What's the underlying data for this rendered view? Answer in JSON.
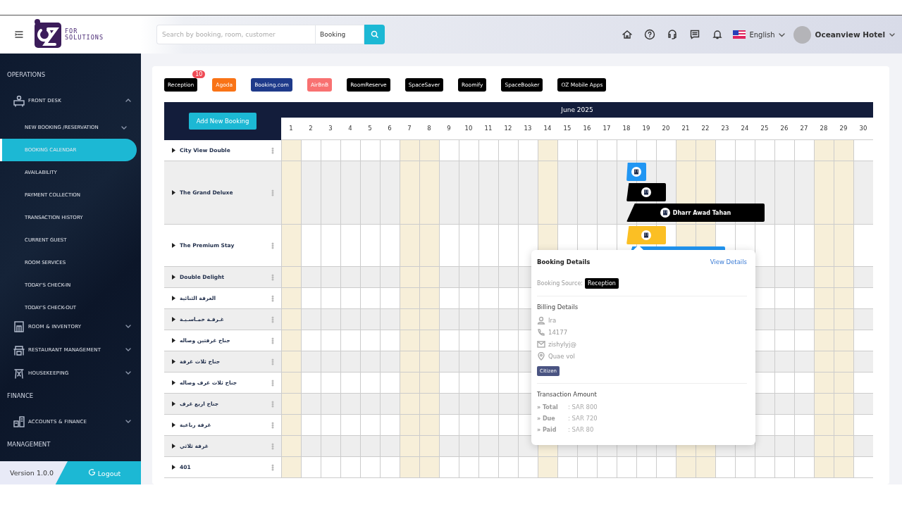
{
  "header": {
    "logo": {
      "line_1": "FOR",
      "line_2": "SOLUTIONS"
    },
    "search": {
      "placeholder": "Search by booking, room, customer",
      "scope": "Booking"
    },
    "language": "English",
    "user": "Oceanview Hotel"
  },
  "sidebar": {
    "sections": [
      {
        "title": "OPERATIONS",
        "items": [
          {
            "label": "FRONT DESK",
            "expanded": true,
            "children": [
              {
                "label": "NEW BOOKING /RESERVATION",
                "kind": "submenu",
                "selected": false
              },
              {
                "label": "BOOKING CALENDAR",
                "kind": "link",
                "selected": true
              },
              {
                "label": "AVAILABILITY",
                "kind": "link",
                "selected": false
              },
              {
                "label": "PAYMENT COLLECTION",
                "kind": "link",
                "selected": false
              },
              {
                "label": "TRANSACTION HISTORY",
                "kind": "link",
                "selected": false
              },
              {
                "label": "CURRENT GUEST",
                "kind": "link",
                "selected": false
              },
              {
                "label": "ROOM SERVICES",
                "kind": "link",
                "selected": false
              },
              {
                "label": "TODAY'S CHECK-IN",
                "kind": "link",
                "selected": false
              },
              {
                "label": "TODAY'S CHECK-OUT",
                "kind": "link",
                "selected": false
              }
            ]
          },
          {
            "label": "ROOM & INVENTORY",
            "expanded": false
          },
          {
            "label": "RESTAURANT MANAGEMENT",
            "expanded": false
          },
          {
            "label": "HOUSEKEEPING",
            "expanded": false
          }
        ]
      },
      {
        "title": "FINANCE",
        "items": [
          {
            "label": "ACCOUNTS & FINANCE",
            "expanded": false
          }
        ]
      },
      {
        "title": "MANAGEMENT"
      }
    ],
    "version": "Version 1.0.0",
    "logout": "Logout"
  },
  "sources": [
    {
      "label": "Reception",
      "color": "#000000",
      "badge": "10"
    },
    {
      "label": "Agoda",
      "color": "#f97316"
    },
    {
      "label": "Booking.com",
      "color": "#1e3a8a"
    },
    {
      "label": "AirBnB",
      "color": "#f87171"
    },
    {
      "label": "RoomReserve",
      "color": "#000000"
    },
    {
      "label": "SpaceSaver",
      "color": "#000000"
    },
    {
      "label": "Roomify",
      "color": "#000000"
    },
    {
      "label": "SpaceBooker",
      "color": "#000000"
    },
    {
      "label": "OZ Mobile Apps",
      "color": "#000000"
    }
  ],
  "calendar": {
    "add_button": "Add New Booking",
    "month": "June 2025",
    "days": [
      {
        "label": "1",
        "highlighted": true
      },
      {
        "label": "2",
        "highlighted": false
      },
      {
        "label": "3",
        "highlighted": false
      },
      {
        "label": "4",
        "highlighted": false
      },
      {
        "label": "5",
        "highlighted": false
      },
      {
        "label": "6",
        "highlighted": false
      },
      {
        "label": "7",
        "highlighted": true
      },
      {
        "label": "8",
        "highlighted": true
      },
      {
        "label": "9",
        "highlighted": false
      },
      {
        "label": "10",
        "highlighted": false
      },
      {
        "label": "11",
        "highlighted": false
      },
      {
        "label": "12",
        "highlighted": false
      },
      {
        "label": "13",
        "highlighted": false
      },
      {
        "label": "14",
        "highlighted": true
      },
      {
        "label": "15",
        "highlighted": false
      },
      {
        "label": "16",
        "highlighted": false
      },
      {
        "label": "17",
        "highlighted": false
      },
      {
        "label": "18",
        "highlighted": false
      },
      {
        "label": "19",
        "highlighted": false
      },
      {
        "label": "20",
        "highlighted": false
      },
      {
        "label": "21",
        "highlighted": true
      },
      {
        "label": "22",
        "highlighted": true
      },
      {
        "label": "23",
        "highlighted": false
      },
      {
        "label": "24",
        "highlighted": false
      },
      {
        "label": "25",
        "highlighted": false
      },
      {
        "label": "26",
        "highlighted": false
      },
      {
        "label": "27",
        "highlighted": false
      },
      {
        "label": "28",
        "highlighted": true
      },
      {
        "label": "29",
        "highlighted": true
      },
      {
        "label": "30",
        "highlighted": false
      }
    ],
    "rooms": [
      {
        "name": "City View Double"
      },
      {
        "name": "The Grand Deluxe",
        "bookings": [
          {
            "color": "#2196f3"
          },
          {
            "color": "#000000"
          },
          {
            "color": "#000000",
            "guest": "Dharr Awad Tahan"
          }
        ]
      },
      {
        "name": "The Premium Stay",
        "bookings": [
          {
            "color": "#fbbf24"
          },
          {
            "color": "#2196f3"
          }
        ]
      },
      {
        "name": "Double Delight"
      },
      {
        "name": "الغرفة الثنائية"
      },
      {
        "name": "غـرفـة خمـاسـيـة"
      },
      {
        "name": "جناح غرفتين وصاله"
      },
      {
        "name": "جناح ثلاث غرفة"
      },
      {
        "name": "جناح ثلاث غرف وصاله"
      },
      {
        "name": "جناح اربع غرف"
      },
      {
        "name": "غرفة رباعية"
      },
      {
        "name": "غرفة ثلاثي"
      },
      {
        "name": "401"
      }
    ]
  },
  "popup": {
    "title": "Booking Details",
    "link": "View Details",
    "source_label": "Booking Source:",
    "source": "Reception",
    "billing_title": "Billing Details",
    "name": "Ira",
    "phone": "14177",
    "email": "zishylyj@",
    "address": "Quae vol",
    "tag": "Citizen",
    "transaction_title": "Transaction Amount",
    "amounts": [
      {
        "label": "» Total",
        "value": ": SAR 800"
      },
      {
        "label": "» Due",
        "value": ": SAR 720"
      },
      {
        "label": "» Paid",
        "value": ": SAR 80"
      }
    ]
  }
}
